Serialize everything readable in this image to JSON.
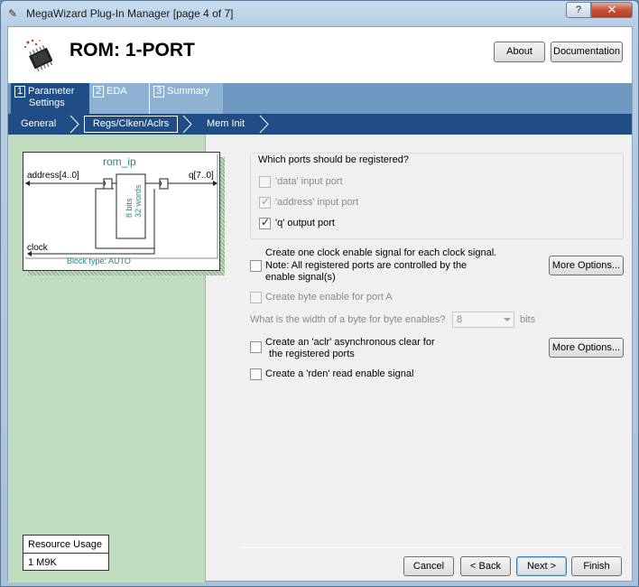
{
  "window": {
    "title": "MegaWizard Plug-In Manager [page 4 of 7]",
    "help_label": "?",
    "close_label": "✕"
  },
  "header": {
    "title": "ROM: 1-PORT",
    "about_label": "About",
    "documentation_label": "Documentation"
  },
  "tabs": [
    {
      "num": "1",
      "label_line1": "Parameter",
      "label_line2": "Settings"
    },
    {
      "num": "2",
      "label": "EDA"
    },
    {
      "num": "3",
      "label": "Summary"
    }
  ],
  "subtabs": {
    "general": "General",
    "regs": "Regs/Clken/Aclrs",
    "mem_init": "Mem Init"
  },
  "symbol": {
    "name": "rom_ip",
    "address_port": "address[4..0]",
    "q_port": "q[7..0]",
    "clock_port": "clock",
    "block_type": "Block type: AUTO",
    "bits_label": "8 bits",
    "words_label": "32 words"
  },
  "resource": {
    "title": "Resource Usage",
    "value": "1 M9K"
  },
  "registered_ports": {
    "title": "Which ports should be registered?",
    "data_port": {
      "label": "'data' input port",
      "checked": false,
      "enabled": false
    },
    "address_port": {
      "label": "'address' input port",
      "checked": true,
      "enabled": false
    },
    "q_port": {
      "label": "'q' output port",
      "checked": true,
      "enabled": true
    }
  },
  "options": {
    "clock_enable_line1": "Create one clock enable signal for each clock signal.",
    "clock_enable_line2": "Note: All registered ports are controlled by the",
    "clock_enable_line3": "enable signal(s)",
    "more_options_1": "More Options...",
    "byte_enable": "Create byte enable for port A",
    "byte_width_question": "What is the width of a byte for byte enables?",
    "byte_width_value": "8",
    "byte_width_unit": "bits",
    "aclr_line1": "Create an 'aclr' asynchronous clear for",
    "aclr_line2": "the registered ports",
    "more_options_2": "More Options...",
    "rden": "Create a 'rden' read enable signal"
  },
  "footer": {
    "cancel": "Cancel",
    "back": "< Back",
    "next": "Next >",
    "finish": "Finish"
  }
}
